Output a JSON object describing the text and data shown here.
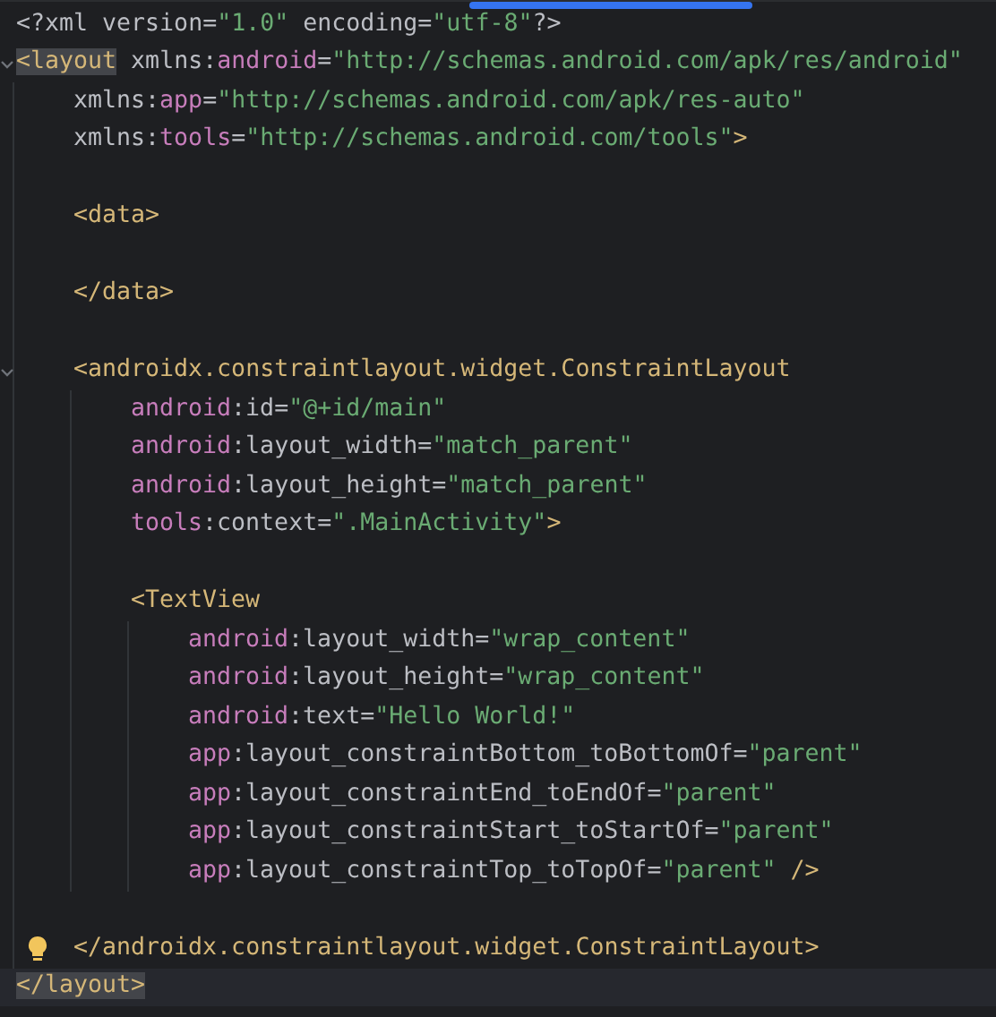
{
  "editor": {
    "lines": [
      {
        "kind": "code",
        "fold": false,
        "tokens": [
          {
            "kind": "plain",
            "text": "<?xml version="
          },
          {
            "kind": "value",
            "text": "\"1.0\""
          },
          {
            "kind": "plain",
            "text": " encoding="
          },
          {
            "kind": "value",
            "text": "\"utf-8\""
          },
          {
            "kind": "plain",
            "text": "?>"
          }
        ]
      },
      {
        "kind": "code",
        "fold": true,
        "tokens": [
          {
            "kind": "tag",
            "text": "<layout",
            "highlighted": true
          },
          {
            "kind": "plain",
            "text": " xmlns:"
          },
          {
            "kind": "ns",
            "text": "android"
          },
          {
            "kind": "plain",
            "text": "="
          },
          {
            "kind": "value",
            "text": "\"http://schemas.android.com/apk/res/android\""
          }
        ],
        "children": [
          {
            "kind": "code",
            "fold": false,
            "tokens": [
              {
                "kind": "plain",
                "text": "xmlns:"
              },
              {
                "kind": "ns",
                "text": "app"
              },
              {
                "kind": "plain",
                "text": "="
              },
              {
                "kind": "value",
                "text": "\"http://schemas.android.com/apk/res-auto\""
              }
            ]
          },
          {
            "kind": "code",
            "fold": false,
            "tokens": [
              {
                "kind": "plain",
                "text": "xmlns:"
              },
              {
                "kind": "ns",
                "text": "tools"
              },
              {
                "kind": "plain",
                "text": "="
              },
              {
                "kind": "value",
                "text": "\"http://schemas.android.com/tools\""
              },
              {
                "kind": "tag",
                "text": ">"
              }
            ]
          },
          {
            "kind": "blank"
          },
          {
            "kind": "code",
            "fold": false,
            "tokens": [
              {
                "kind": "tag",
                "text": "<data>"
              }
            ]
          },
          {
            "kind": "blank"
          },
          {
            "kind": "code",
            "fold": false,
            "tokens": [
              {
                "kind": "tag",
                "text": "</data>"
              }
            ]
          },
          {
            "kind": "blank"
          },
          {
            "kind": "code",
            "fold": true,
            "tokens": [
              {
                "kind": "tag",
                "text": "<androidx.constraintlayout.widget.ConstraintLayout"
              }
            ],
            "children": [
              {
                "kind": "code",
                "fold": false,
                "tokens": [
                  {
                    "kind": "ns",
                    "text": "android"
                  },
                  {
                    "kind": "plain",
                    "text": ":id="
                  },
                  {
                    "kind": "value",
                    "text": "\"@+id/main\""
                  }
                ]
              },
              {
                "kind": "code",
                "fold": false,
                "tokens": [
                  {
                    "kind": "ns",
                    "text": "android"
                  },
                  {
                    "kind": "plain",
                    "text": ":layout_width="
                  },
                  {
                    "kind": "value",
                    "text": "\"match_parent\""
                  }
                ]
              },
              {
                "kind": "code",
                "fold": false,
                "tokens": [
                  {
                    "kind": "ns",
                    "text": "android"
                  },
                  {
                    "kind": "plain",
                    "text": ":layout_height="
                  },
                  {
                    "kind": "value",
                    "text": "\"match_parent\""
                  }
                ]
              },
              {
                "kind": "code",
                "fold": false,
                "tokens": [
                  {
                    "kind": "ns",
                    "text": "tools"
                  },
                  {
                    "kind": "plain",
                    "text": ":context="
                  },
                  {
                    "kind": "value",
                    "text": "\".MainActivity\""
                  },
                  {
                    "kind": "tag",
                    "text": ">"
                  }
                ]
              },
              {
                "kind": "blank"
              },
              {
                "kind": "code",
                "fold": false,
                "tokens": [
                  {
                    "kind": "tag",
                    "text": "<TextView"
                  }
                ],
                "children": [
                  {
                    "kind": "code",
                    "fold": false,
                    "tokens": [
                      {
                        "kind": "ns",
                        "text": "android"
                      },
                      {
                        "kind": "plain",
                        "text": ":layout_width="
                      },
                      {
                        "kind": "value",
                        "text": "\"wrap_content\""
                      }
                    ]
                  },
                  {
                    "kind": "code",
                    "fold": false,
                    "tokens": [
                      {
                        "kind": "ns",
                        "text": "android"
                      },
                      {
                        "kind": "plain",
                        "text": ":layout_height="
                      },
                      {
                        "kind": "value",
                        "text": "\"wrap_content\""
                      }
                    ]
                  },
                  {
                    "kind": "code",
                    "fold": false,
                    "tokens": [
                      {
                        "kind": "ns",
                        "text": "android"
                      },
                      {
                        "kind": "plain",
                        "text": ":text="
                      },
                      {
                        "kind": "value",
                        "text": "\"Hello World!\""
                      }
                    ]
                  },
                  {
                    "kind": "code",
                    "fold": false,
                    "tokens": [
                      {
                        "kind": "ns",
                        "text": "app"
                      },
                      {
                        "kind": "plain",
                        "text": ":layout_constraintBottom_toBottomOf="
                      },
                      {
                        "kind": "value",
                        "text": "\"parent\""
                      }
                    ]
                  },
                  {
                    "kind": "code",
                    "fold": false,
                    "tokens": [
                      {
                        "kind": "ns",
                        "text": "app"
                      },
                      {
                        "kind": "plain",
                        "text": ":layout_constraintEnd_toEndOf="
                      },
                      {
                        "kind": "value",
                        "text": "\"parent\""
                      }
                    ]
                  },
                  {
                    "kind": "code",
                    "fold": false,
                    "tokens": [
                      {
                        "kind": "ns",
                        "text": "app"
                      },
                      {
                        "kind": "plain",
                        "text": ":layout_constraintStart_toStartOf="
                      },
                      {
                        "kind": "value",
                        "text": "\"parent\""
                      }
                    ]
                  },
                  {
                    "kind": "code",
                    "fold": false,
                    "tokens": [
                      {
                        "kind": "ns",
                        "text": "app"
                      },
                      {
                        "kind": "plain",
                        "text": ":layout_constraintTop_toTopOf="
                      },
                      {
                        "kind": "value",
                        "text": "\"parent\""
                      },
                      {
                        "kind": "tag",
                        "text": " />"
                      }
                    ]
                  }
                ]
              }
            ]
          },
          {
            "kind": "blank"
          },
          {
            "kind": "code",
            "fold": false,
            "bulb": true,
            "tokens": [
              {
                "kind": "tag",
                "text": "</androidx.constraintlayout.widget.ConstraintLayout>"
              }
            ]
          }
        ]
      },
      {
        "kind": "code",
        "fold": false,
        "current": true,
        "tokens": [
          {
            "kind": "tag",
            "text": "</layout>",
            "highlighted": true
          }
        ]
      }
    ]
  }
}
